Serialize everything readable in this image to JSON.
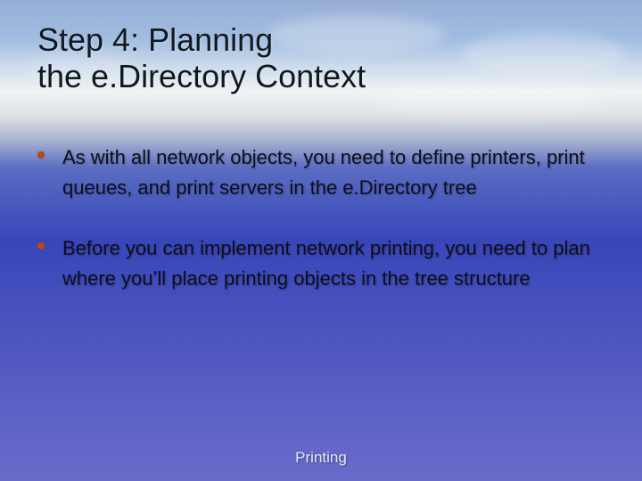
{
  "title_line1": "Step 4: Planning",
  "title_line2": "the e.Directory Context",
  "bullets": [
    "As with all network objects, you need to define printers, print queues, and print servers in the e.Directory tree",
    "Before you can implement network printing, you need to plan where you’ll place printing objects in the tree structure"
  ],
  "footer": "Printing"
}
